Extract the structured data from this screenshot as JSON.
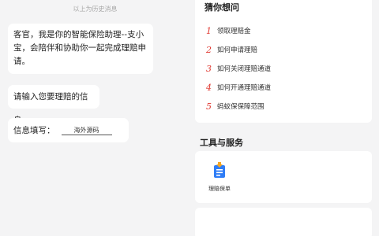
{
  "chat": {
    "history_divider": "以上为历史消息",
    "greeting": "客官，我是你的智能保险助理--支小宝，会陪伴和协助你一起完成理赔申请。",
    "prompt": "请输入您要理赔的信息",
    "field_label": "信息填写：",
    "field_value": "海外源码"
  },
  "guess": {
    "title": "猜你想问",
    "items": [
      {
        "num": "1",
        "label": "领取理赔金"
      },
      {
        "num": "2",
        "label": "如何申请理赔"
      },
      {
        "num": "3",
        "label": "如何关闭理赔通道"
      },
      {
        "num": "4",
        "label": "如何开通理赔通道"
      },
      {
        "num": "5",
        "label": "蚂蚁保保障范围"
      }
    ]
  },
  "tools": {
    "title": "工具与服务",
    "items": [
      {
        "label": "理赔保单",
        "icon": "claim-document-icon"
      }
    ]
  },
  "colors": {
    "accent_red": "#e0372f",
    "icon_blue": "#2f7df6",
    "icon_orange": "#f5a623"
  }
}
